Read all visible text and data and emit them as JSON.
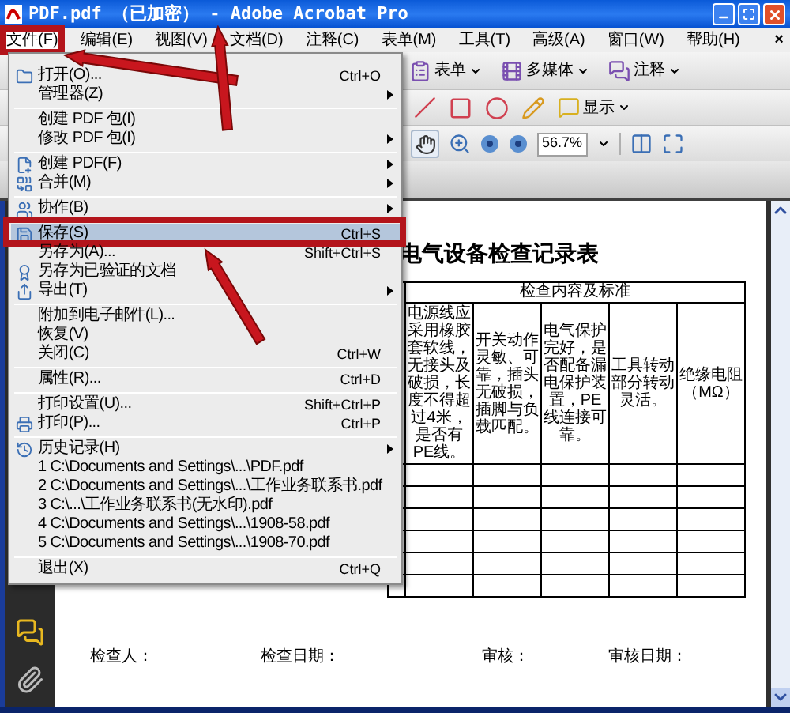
{
  "window": {
    "title": "PDF.pdf （已加密） - Adobe Acrobat Pro"
  },
  "menu_bar": {
    "items": [
      {
        "label": "文件(F)",
        "selected": true,
        "framed": true
      },
      {
        "label": "编辑(E)",
        "selected": false,
        "framed": false
      },
      {
        "label": "视图(V)",
        "selected": false,
        "framed": false
      },
      {
        "label": "文档(D)",
        "selected": false,
        "framed": false
      },
      {
        "label": "注释(C)",
        "selected": false,
        "framed": false
      },
      {
        "label": "表单(M)",
        "selected": false,
        "framed": false
      },
      {
        "label": "工具(T)",
        "selected": false,
        "framed": false
      },
      {
        "label": "高级(A)",
        "selected": false,
        "framed": false
      },
      {
        "label": "窗口(W)",
        "selected": false,
        "framed": false
      },
      {
        "label": "帮助(H)",
        "selected": false,
        "framed": false
      }
    ],
    "close": "×"
  },
  "file_menu": {
    "items": [
      {
        "kind": "item",
        "label": "打开(O)...",
        "shortcut": "Ctrl+O",
        "submenu": false,
        "selected": false,
        "framed": false
      },
      {
        "kind": "item",
        "label": "管理器(Z)",
        "submenu": true,
        "selected": false,
        "framed": false
      },
      {
        "kind": "separator"
      },
      {
        "kind": "item",
        "label": "创建 PDF 包(I)",
        "submenu": false,
        "selected": false,
        "framed": false
      },
      {
        "kind": "item",
        "label": "修改 PDF 包(I)",
        "submenu": true,
        "selected": false,
        "framed": false
      },
      {
        "kind": "separator"
      },
      {
        "kind": "item",
        "label": "创建 PDF(F)",
        "submenu": true,
        "selected": false,
        "framed": false
      },
      {
        "kind": "item",
        "label": "合并(M)",
        "submenu": true,
        "selected": false,
        "framed": false
      },
      {
        "kind": "separator"
      },
      {
        "kind": "item",
        "label": "协作(B)",
        "submenu": true,
        "selected": false,
        "framed": false
      },
      {
        "kind": "separator"
      },
      {
        "kind": "item",
        "label": "保存(S)",
        "shortcut": "Ctrl+S",
        "submenu": false,
        "selected": true,
        "framed": true
      },
      {
        "kind": "item",
        "label": "另存为(A)...",
        "shortcut": "Shift+Ctrl+S",
        "submenu": false,
        "selected": false,
        "framed": false
      },
      {
        "kind": "item",
        "label": "另存为已验证的文档",
        "submenu": false,
        "selected": false,
        "framed": false
      },
      {
        "kind": "item",
        "label": "导出(T)",
        "submenu": true,
        "selected": false,
        "framed": false
      },
      {
        "kind": "separator"
      },
      {
        "kind": "item",
        "label": "附加到电子邮件(L)...",
        "submenu": false,
        "selected": false,
        "framed": false
      },
      {
        "kind": "item",
        "label": "恢复(V)",
        "submenu": false,
        "selected": false,
        "framed": false
      },
      {
        "kind": "item",
        "label": "关闭(C)",
        "shortcut": "Ctrl+W",
        "submenu": false,
        "selected": false,
        "framed": false
      },
      {
        "kind": "separator"
      },
      {
        "kind": "item",
        "label": "属性(R)...",
        "shortcut": "Ctrl+D",
        "submenu": false,
        "selected": false,
        "framed": false
      },
      {
        "kind": "separator"
      },
      {
        "kind": "item",
        "label": "打印设置(U)...",
        "shortcut": "Shift+Ctrl+P",
        "submenu": false,
        "selected": false,
        "framed": false
      },
      {
        "kind": "item",
        "label": "打印(P)...",
        "shortcut": "Ctrl+P",
        "submenu": false,
        "selected": false,
        "framed": false
      },
      {
        "kind": "separator"
      },
      {
        "kind": "item",
        "label": "历史记录(H)",
        "submenu": true,
        "selected": false,
        "framed": false
      },
      {
        "kind": "item",
        "label": "1 C:\\Documents and Settings\\...\\PDF.pdf",
        "submenu": false,
        "selected": false,
        "framed": false
      },
      {
        "kind": "item",
        "label": "2 C:\\Documents and Settings\\...\\工作业务联系书.pdf",
        "submenu": false,
        "selected": false,
        "framed": false
      },
      {
        "kind": "item",
        "label": "3 C:\\...\\工作业务联系书(无水印).pdf",
        "submenu": false,
        "selected": false,
        "framed": false
      },
      {
        "kind": "item",
        "label": "4 C:\\Documents and Settings\\...\\1908-58.pdf",
        "submenu": false,
        "selected": false,
        "framed": false
      },
      {
        "kind": "item",
        "label": "5 C:\\Documents and Settings\\...\\1908-70.pdf",
        "submenu": false,
        "selected": false,
        "framed": false
      },
      {
        "kind": "separator"
      },
      {
        "kind": "item",
        "label": "退出(X)",
        "shortcut": "Ctrl+Q",
        "submenu": false,
        "selected": false,
        "framed": false
      }
    ]
  },
  "toolbar": {
    "menus": [
      "表单",
      "多媒体",
      "注释"
    ],
    "display": "显示",
    "hand_tool": {
      "selected": true
    },
    "zoom": {
      "value": "56.7%"
    }
  },
  "document": {
    "title": "电气设备检查记录表",
    "table": {
      "group_header": "检查内容及标准",
      "columns": [
        "电源线应采用橡胶套软线，无接头及破损，长度不得超过4米，是否有PE线。",
        "开关动作灵敏、可靠，插头无破损，插脚与负载匹配。",
        "电气保护完好，是否配备漏电保护装置，PE线连接可靠。",
        "工具转动部分转动灵活。",
        "绝缘电阻（MΩ）"
      ]
    },
    "signatures": [
      "检查人：",
      "检查日期：",
      "审核：",
      "审核日期："
    ]
  }
}
